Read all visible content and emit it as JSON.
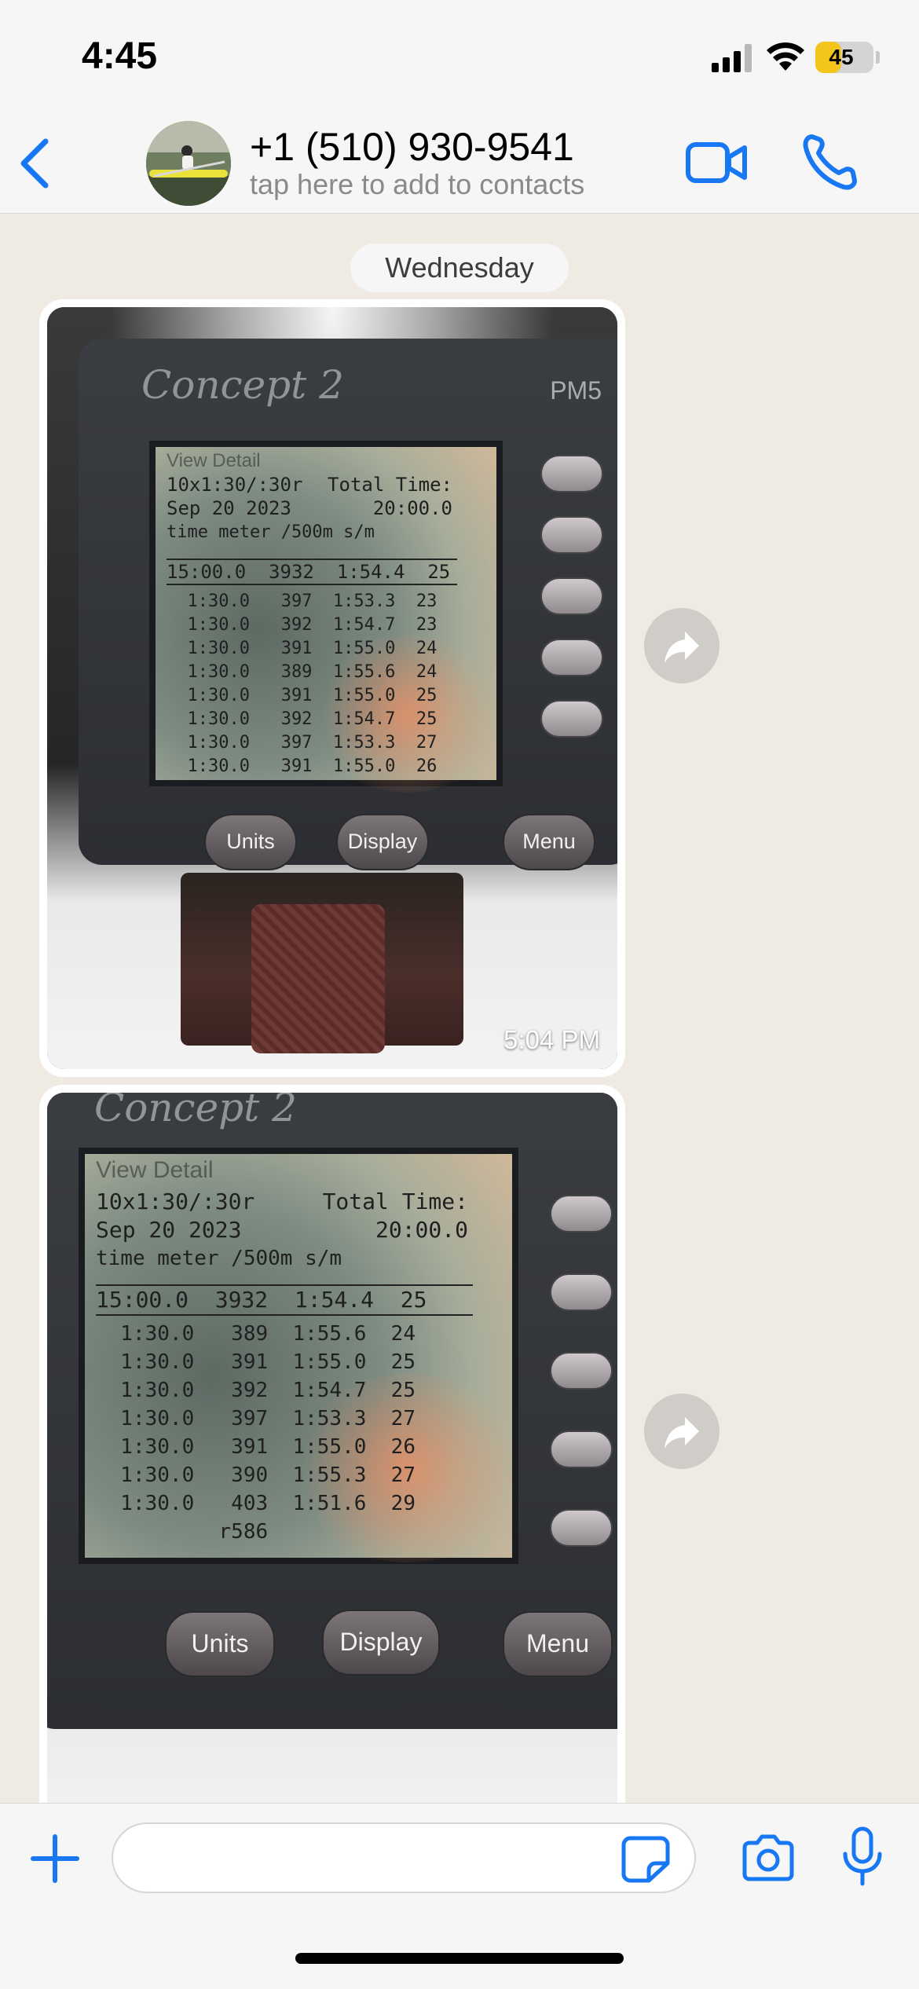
{
  "status_bar": {
    "time": "4:45",
    "battery_level": "45",
    "battery_fraction": 0.45,
    "battery_color": "#f4c61c"
  },
  "header": {
    "contact_name": "+1 (510) 930-9541",
    "contact_subtitle": "tap here to add to contacts",
    "accent_color": "#1877f2"
  },
  "chat": {
    "day_label": "Wednesday",
    "messages": [
      {
        "type": "image",
        "timestamp": "5:04 PM",
        "photo": {
          "brand": "Concept 2",
          "model": "PM5",
          "lcd_title": "View Detail",
          "workout": "10x1:30/:30r",
          "total_time_label": "Total Time:",
          "date": "Sep 20 2023",
          "total_time": "20:00.0",
          "columns": "  time   meter  /500m  s/m",
          "summary": "15:00.0  3932  1:54.4  25",
          "rows": [
            "  1:30.0   397  1:53.3  23",
            "  1:30.0   392  1:54.7  23",
            "  1:30.0   391  1:55.0  24",
            "  1:30.0   389  1:55.6  24",
            "  1:30.0   391  1:55.0  25",
            "  1:30.0   392  1:54.7  25",
            "  1:30.0   397  1:53.3  27",
            "  1:30.0   391  1:55.0  26"
          ],
          "buttons": [
            "Units",
            "Display",
            "Menu"
          ]
        }
      },
      {
        "type": "image",
        "photo": {
          "brand": "Concept 2",
          "lcd_title": "View Detail",
          "workout": "10x1:30/:30r",
          "total_time_label": "Total Time:",
          "date": "Sep 20 2023",
          "total_time": "20:00.0",
          "columns": "  time   meter  /500m  s/m",
          "summary": "15:00.0  3932  1:54.4  25",
          "rows": [
            "  1:30.0   389  1:55.6  24",
            "  1:30.0   391  1:55.0  25",
            "  1:30.0   392  1:54.7  25",
            "  1:30.0   397  1:53.3  27",
            "  1:30.0   391  1:55.0  26",
            "  1:30.0   390  1:55.3  27",
            "  1:30.0   403  1:51.6  29",
            "          r586"
          ],
          "buttons": [
            "Units",
            "Display",
            "Menu"
          ]
        }
      }
    ]
  },
  "input_bar": {
    "placeholder": ""
  },
  "icons": {
    "back": "chevron-left-icon",
    "video": "video-camera-icon",
    "call": "phone-icon",
    "forward": "forward-arrow-icon",
    "plus": "plus-icon",
    "sticker": "sticker-icon",
    "camera": "camera-icon",
    "mic": "microphone-icon"
  }
}
